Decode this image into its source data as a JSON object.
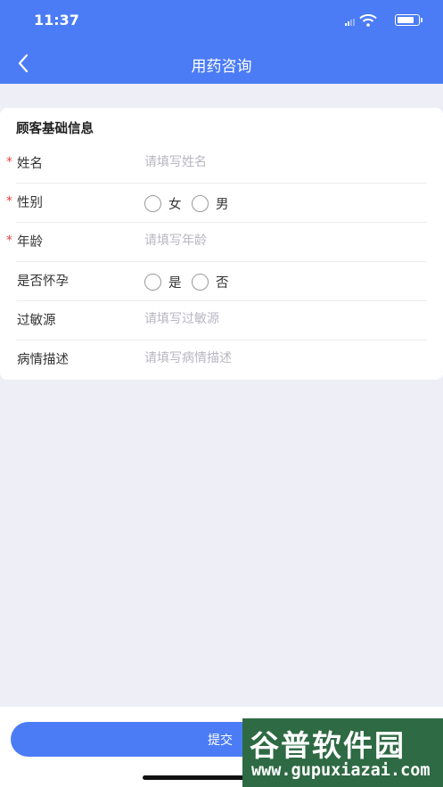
{
  "status_bar": {
    "time": "11:37"
  },
  "nav": {
    "title": "用药咨询"
  },
  "form": {
    "section_title": "顾客基础信息",
    "required_mark": "*",
    "name": {
      "label": "姓名",
      "placeholder": "请填写姓名",
      "value": ""
    },
    "gender": {
      "label": "性别",
      "options": [
        "女",
        "男"
      ],
      "selected": ""
    },
    "age": {
      "label": "年龄",
      "placeholder": "请填写年龄",
      "value": ""
    },
    "pregnant": {
      "label": "是否怀孕",
      "options": [
        "是",
        "否"
      ],
      "selected": ""
    },
    "allergy": {
      "label": "过敏源",
      "placeholder": "请填写过敏源",
      "value": ""
    },
    "condition": {
      "label": "病情描述",
      "placeholder": "请填写病情描述",
      "value": ""
    }
  },
  "submit": {
    "label": "提交"
  },
  "watermark": {
    "main": "谷普软件园",
    "url": "www.gupuxiazai.com"
  },
  "colors": {
    "primary": "#4b7cf5",
    "required": "#e64444",
    "background": "#eeeef6"
  }
}
